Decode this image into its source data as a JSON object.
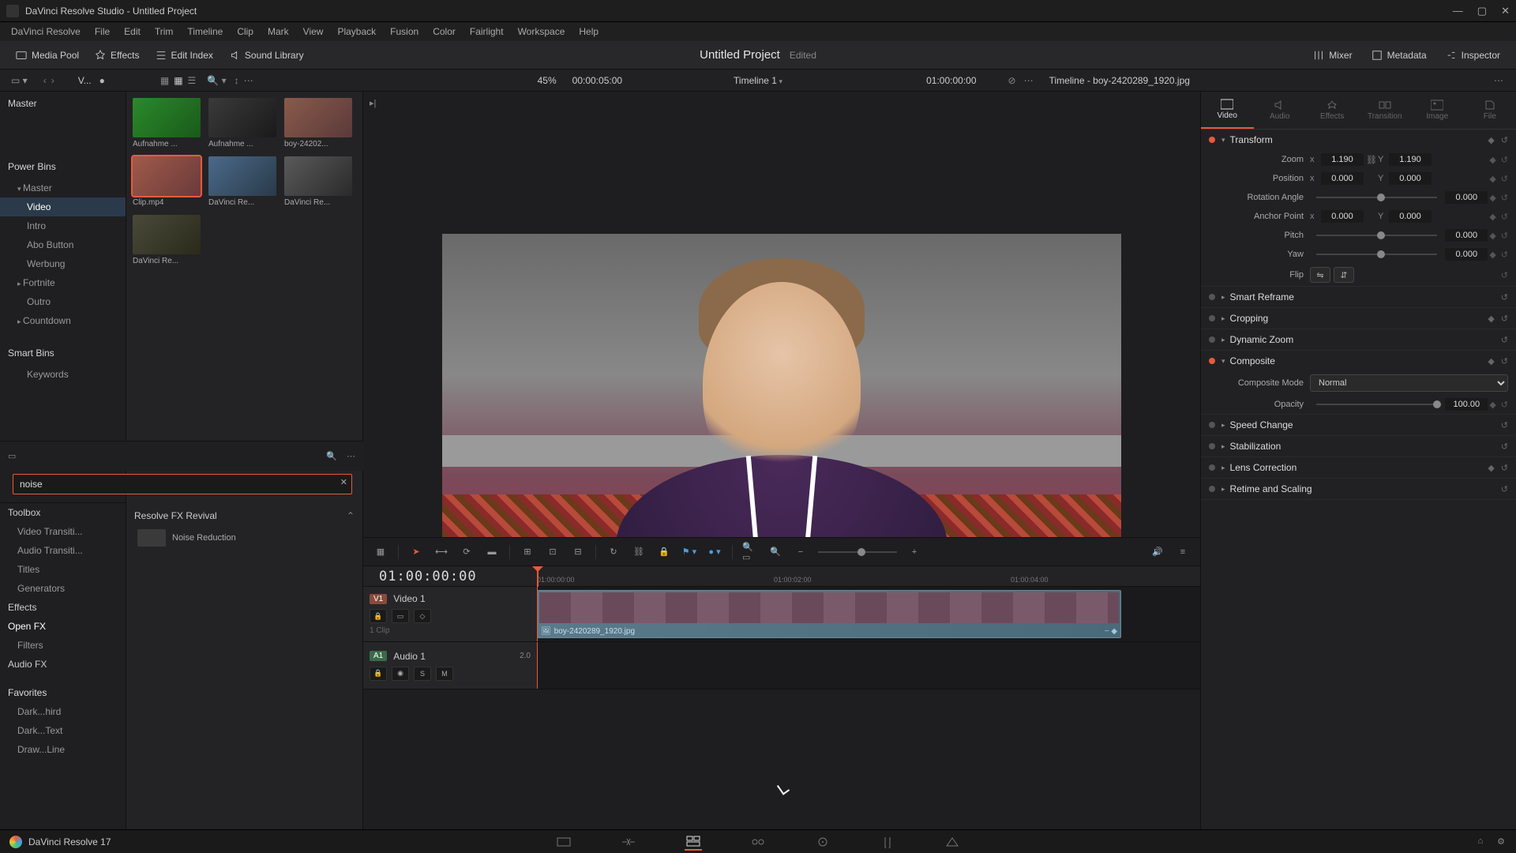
{
  "window": {
    "title": "DaVinci Resolve Studio - Untitled Project"
  },
  "menu": [
    "DaVinci Resolve",
    "File",
    "Edit",
    "Trim",
    "Timeline",
    "Clip",
    "Mark",
    "View",
    "Playback",
    "Fusion",
    "Color",
    "Fairlight",
    "Workspace",
    "Help"
  ],
  "toolbar": {
    "media_pool": "Media Pool",
    "effects": "Effects",
    "edit_index": "Edit Index",
    "sound_library": "Sound Library",
    "mixer": "Mixer",
    "metadata": "Metadata",
    "inspector": "Inspector",
    "project": "Untitled Project",
    "state": "Edited"
  },
  "infobar": {
    "view_label": "V...",
    "zoom": "45%",
    "tc": "00:00:05:00",
    "timeline_name": "Timeline 1",
    "end_tc": "01:00:00:00",
    "clip": "Timeline - boy-2420289_1920.jpg"
  },
  "media_panel": {
    "master": "Master",
    "power_bins": "Power Bins",
    "master2": "Master",
    "video": "Video",
    "intro": "Intro",
    "abo": "Abo Button",
    "werbung": "Werbung",
    "fortnite": "Fortnite",
    "outro": "Outro",
    "countdown": "Countdown",
    "smart_bins": "Smart Bins",
    "keywords": "Keywords",
    "thumbs": [
      {
        "label": "Aufnahme ..."
      },
      {
        "label": "Aufnahme ..."
      },
      {
        "label": "boy-24202..."
      },
      {
        "label": "Clip.mp4",
        "selected": true
      },
      {
        "label": "DaVinci Re..."
      },
      {
        "label": "DaVinci Re..."
      },
      {
        "label": "DaVinci Re..."
      }
    ]
  },
  "fx": {
    "search": "noise",
    "toolbox": "Toolbox",
    "video_tx": "Video Transiti...",
    "audio_tx": "Audio Transiti...",
    "titles": "Titles",
    "generators": "Generators",
    "effects": "Effects",
    "open_fx": "Open FX",
    "filters": "Filters",
    "audio_fx": "Audio FX",
    "favorites": "Favorites",
    "fav1": "Dark...hird",
    "fav2": "Dark...Text",
    "fav3": "Draw...Line",
    "group": "Resolve FX Revival",
    "item": "Noise Reduction"
  },
  "inspector": {
    "tabs": {
      "video": "Video",
      "audio": "Audio",
      "effects": "Effects",
      "transition": "Transition",
      "image": "Image",
      "file": "File"
    },
    "transform": {
      "title": "Transform",
      "zoom": "Zoom",
      "zoom_x": "1.190",
      "zoom_y": "1.190",
      "position": "Position",
      "pos_x": "0.000",
      "pos_y": "0.000",
      "rotation": "Rotation Angle",
      "rot_v": "0.000",
      "anchor": "Anchor Point",
      "anc_x": "0.000",
      "anc_y": "0.000",
      "pitch": "Pitch",
      "pitch_v": "0.000",
      "yaw": "Yaw",
      "yaw_v": "0.000",
      "flip": "Flip"
    },
    "smart_reframe": "Smart Reframe",
    "cropping": "Cropping",
    "dynamic_zoom": "Dynamic Zoom",
    "composite": {
      "title": "Composite",
      "mode_label": "Composite Mode",
      "mode": "Normal",
      "opacity_label": "Opacity",
      "opacity": "100.00"
    },
    "speed": "Speed Change",
    "stabilization": "Stabilization",
    "lens": "Lens Correction",
    "retime": "Retime and Scaling"
  },
  "timeline": {
    "tc": "01:00:00:00",
    "ticks": [
      "01:00:00:00",
      "01:00:02:00",
      "01:00:04:00"
    ],
    "v1": {
      "tag": "V1",
      "name": "Video 1",
      "clips": "1 Clip"
    },
    "a1": {
      "tag": "A1",
      "name": "Audio 1",
      "ch": "2.0"
    },
    "clip_name": "boy-2420289_1920.jpg"
  },
  "app": {
    "name": "DaVinci Resolve 17"
  }
}
